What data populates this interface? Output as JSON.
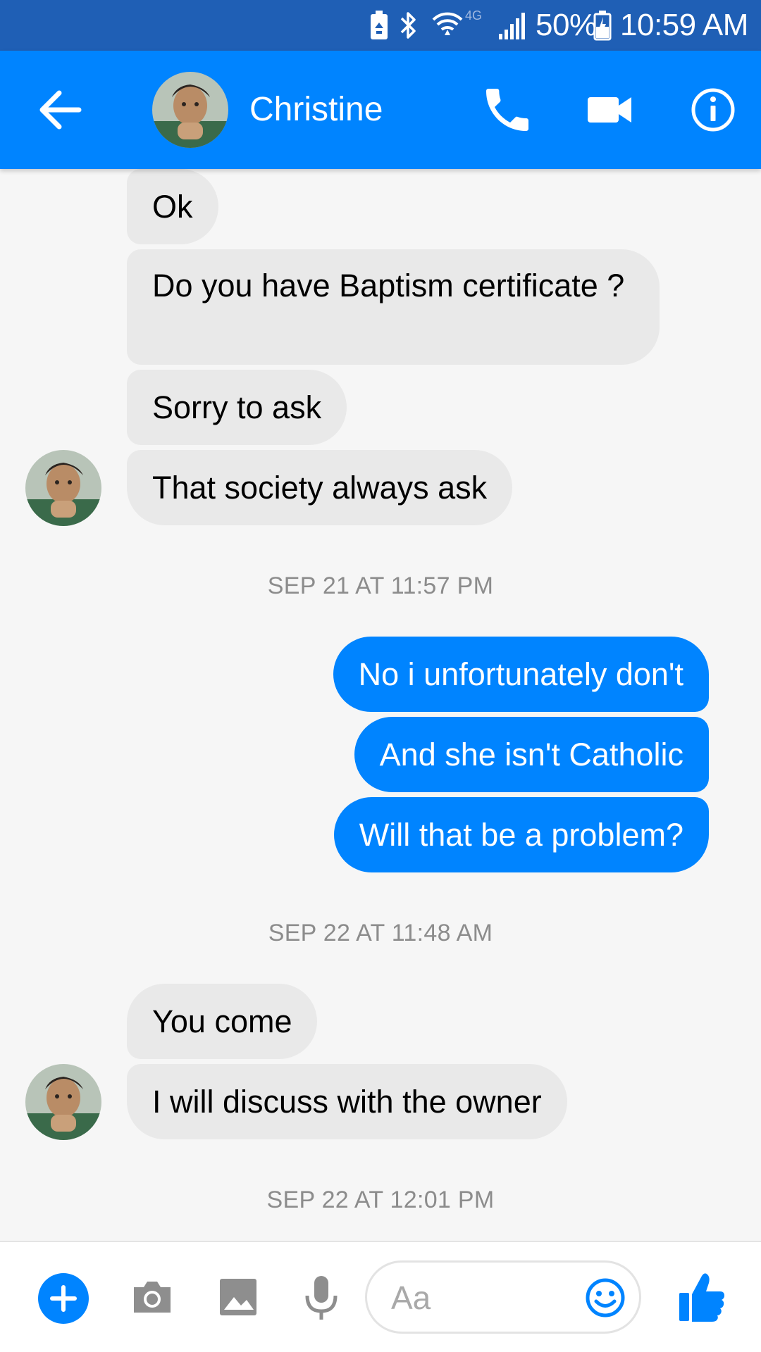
{
  "status_bar": {
    "battery_percent": "50%",
    "time": "10:59 AM",
    "network": "4G",
    "icons": [
      "battery-saver-icon",
      "bluetooth-icon",
      "wifi-icon",
      "signal-icon",
      "battery-icon"
    ]
  },
  "header": {
    "contact_name": "Christine",
    "icons": [
      "back-arrow-icon",
      "phone-icon",
      "video-camera-icon",
      "info-icon"
    ]
  },
  "messages": [
    {
      "direction": "in",
      "text": "Ok"
    },
    {
      "direction": "in",
      "text": "Do you have Baptism certificate ?"
    },
    {
      "direction": "in",
      "text": "Sorry to ask"
    },
    {
      "direction": "in",
      "text": "That society always ask"
    },
    {
      "timestamp": "SEP 21 AT 11:57 PM"
    },
    {
      "direction": "out",
      "text": "No i unfortunately don't"
    },
    {
      "direction": "out",
      "text": "And she isn't Catholic"
    },
    {
      "direction": "out",
      "text": "Will that be a problem?"
    },
    {
      "timestamp": "SEP 22 AT 11:48 AM"
    },
    {
      "direction": "in",
      "text": "You come"
    },
    {
      "direction": "in",
      "text": "I will discuss with the owner"
    },
    {
      "timestamp": "SEP 22 AT 12:01 PM"
    }
  ],
  "composer": {
    "placeholder": "Aa",
    "icons": [
      "plus-icon",
      "camera-icon",
      "image-icon",
      "microphone-icon",
      "emoji-icon",
      "thumbs-up-icon"
    ]
  },
  "colors": {
    "status_bar": "#1f5fb5",
    "accent": "#0084ff",
    "incoming_bubble": "#e9e9e9",
    "background": "#f6f6f6",
    "timestamp_text": "#8c8c8c"
  }
}
